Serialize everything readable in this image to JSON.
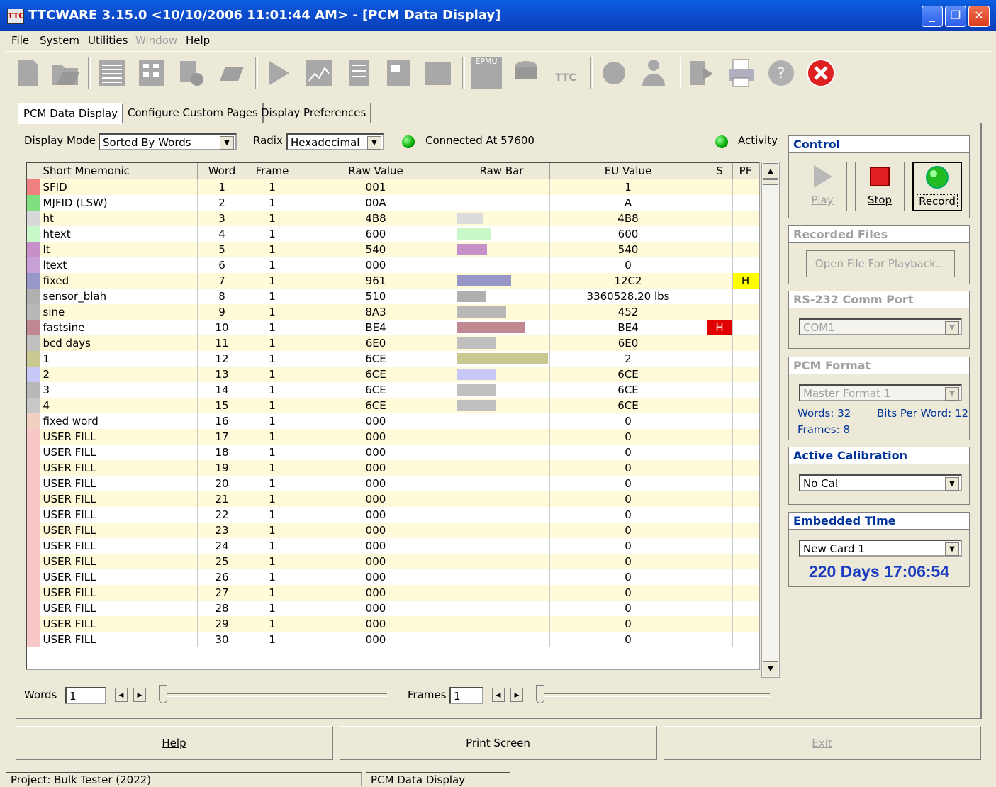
{
  "window": {
    "title": "TTCWARE 3.15.0 <10/10/2006 11:01:44 AM>  - [PCM Data Display]",
    "app_icon_text": "TTC"
  },
  "menu": [
    {
      "label": "File",
      "enabled": true
    },
    {
      "label": "System",
      "enabled": true
    },
    {
      "label": "Utilities",
      "enabled": true
    },
    {
      "label": "Window",
      "enabled": false
    },
    {
      "label": "Help",
      "enabled": true
    }
  ],
  "toolbar": {
    "icons": [
      "new-file-icon",
      "open-folder-icon",
      "list-view-icon",
      "grid-view-icon",
      "settings-gear-icon",
      "tape-icon",
      "play-icon",
      "chart-icon",
      "document-icon",
      "card-icon",
      "module-icon",
      "epmu-icon",
      "disk-icon",
      "ttc-icon",
      "network-icon",
      "user-icon",
      "export-icon",
      "print-icon",
      "help-icon",
      "close-icon"
    ],
    "epmu_label": "EPMU",
    "ttc_label": "TTC"
  },
  "tabs": [
    "PCM Data Display",
    "Configure Custom Pages",
    "Display Preferences"
  ],
  "display_mode": {
    "label": "Display Mode",
    "value": "Sorted By Words"
  },
  "radix": {
    "label": "Radix",
    "value": "Hexadecimal"
  },
  "connection": {
    "status": "Connected At 57600"
  },
  "activity": {
    "label": "Activity"
  },
  "grid": {
    "columns": [
      "Short Mnemonic",
      "Word",
      "Frame",
      "Raw Value",
      "Raw Bar",
      "EU Value",
      "S",
      "PF"
    ],
    "rows": [
      {
        "color": "#f08080",
        "mnemonic": "SFID",
        "word": "1",
        "frame": "1",
        "raw": "001",
        "bar": 0,
        "bar_color": "",
        "eu": "1",
        "s": "",
        "s_color": "",
        "pf": "",
        "pf_color": ""
      },
      {
        "color": "#80e080",
        "mnemonic": "MJFID (LSW)",
        "word": "2",
        "frame": "1",
        "raw": "00A",
        "bar": 0,
        "bar_color": "",
        "eu": "A",
        "s": "",
        "s_color": "",
        "pf": "",
        "pf_color": ""
      },
      {
        "color": "#d8d8d8",
        "mnemonic": "ht",
        "word": "3",
        "frame": "1",
        "raw": "4B8",
        "bar": 0.29,
        "bar_color": "#dcdcdc",
        "eu": "4B8",
        "s": "",
        "s_color": "",
        "pf": "",
        "pf_color": ""
      },
      {
        "color": "#c8f8c8",
        "mnemonic": "htext",
        "word": "4",
        "frame": "1",
        "raw": "600",
        "bar": 0.37,
        "bar_color": "#c8f8c8",
        "eu": "600",
        "s": "",
        "s_color": "",
        "pf": "",
        "pf_color": ""
      },
      {
        "color": "#c890c8",
        "mnemonic": "lt",
        "word": "5",
        "frame": "1",
        "raw": "540",
        "bar": 0.33,
        "bar_color": "#c890c8",
        "eu": "540",
        "s": "",
        "s_color": "",
        "pf": "",
        "pf_color": ""
      },
      {
        "color": "#c8a0d8",
        "mnemonic": "ltext",
        "word": "6",
        "frame": "1",
        "raw": "000",
        "bar": 0,
        "bar_color": "",
        "eu": "0",
        "s": "",
        "s_color": "",
        "pf": "",
        "pf_color": ""
      },
      {
        "color": "#9898c8",
        "mnemonic": "fixed",
        "word": "7",
        "frame": "1",
        "raw": "961",
        "bar": 0.59,
        "bar_color": "#9898c8",
        "eu": "12C2",
        "s": "",
        "s_color": "",
        "pf": "H",
        "pf_color": "#ffff00"
      },
      {
        "color": "#b0b0b0",
        "mnemonic": "sensor_blah",
        "word": "8",
        "frame": "1",
        "raw": "510",
        "bar": 0.31,
        "bar_color": "#b0b0b0",
        "eu": "3360528.20 lbs",
        "s": "",
        "s_color": "",
        "pf": "",
        "pf_color": ""
      },
      {
        "color": "#b8b8b8",
        "mnemonic": "sine",
        "word": "9",
        "frame": "1",
        "raw": "8A3",
        "bar": 0.54,
        "bar_color": "#b8b8b8",
        "eu": "452",
        "s": "",
        "s_color": "",
        "pf": "",
        "pf_color": ""
      },
      {
        "color": "#c08890",
        "mnemonic": "fastsine",
        "word": "10",
        "frame": "1",
        "raw": "BE4",
        "bar": 0.74,
        "bar_color": "#c08890",
        "eu": "BE4",
        "s": "H",
        "s_color": "#e00000",
        "pf": "",
        "pf_color": ""
      },
      {
        "color": "#c0c0c0",
        "mnemonic": "bcd days",
        "word": "11",
        "frame": "1",
        "raw": "6E0",
        "bar": 0.43,
        "bar_color": "#c0c0c0",
        "eu": "6E0",
        "s": "",
        "s_color": "",
        "pf": "",
        "pf_color": ""
      },
      {
        "color": "#c8c890",
        "mnemonic": "1",
        "word": "12",
        "frame": "1",
        "raw": "6CE",
        "bar": 1.0,
        "bar_color": "#c8c890",
        "eu": "2",
        "s": "",
        "s_color": "",
        "pf": "",
        "pf_color": ""
      },
      {
        "color": "#c8c8f8",
        "mnemonic": "2",
        "word": "13",
        "frame": "1",
        "raw": "6CE",
        "bar": 0.43,
        "bar_color": "#c8c8f8",
        "eu": "6CE",
        "s": "",
        "s_color": "",
        "pf": "",
        "pf_color": ""
      },
      {
        "color": "#b8b8b8",
        "mnemonic": "3",
        "word": "14",
        "frame": "1",
        "raw": "6CE",
        "bar": 0.43,
        "bar_color": "#c0c0c0",
        "eu": "6CE",
        "s": "",
        "s_color": "",
        "pf": "",
        "pf_color": ""
      },
      {
        "color": "#c8c8c8",
        "mnemonic": "4",
        "word": "15",
        "frame": "1",
        "raw": "6CE",
        "bar": 0.43,
        "bar_color": "#c0c0c0",
        "eu": "6CE",
        "s": "",
        "s_color": "",
        "pf": "",
        "pf_color": ""
      },
      {
        "color": "#f0d0c0",
        "mnemonic": "fixed word",
        "word": "16",
        "frame": "1",
        "raw": "000",
        "bar": 0,
        "bar_color": "",
        "eu": "0",
        "s": "",
        "s_color": "",
        "pf": "",
        "pf_color": ""
      },
      {
        "color": "#f8c8c8",
        "mnemonic": "USER FILL",
        "word": "17",
        "frame": "1",
        "raw": "000",
        "bar": 0,
        "bar_color": "",
        "eu": "0",
        "s": "",
        "s_color": "",
        "pf": "",
        "pf_color": ""
      },
      {
        "color": "#f8c8c8",
        "mnemonic": "USER FILL",
        "word": "18",
        "frame": "1",
        "raw": "000",
        "bar": 0,
        "bar_color": "",
        "eu": "0",
        "s": "",
        "s_color": "",
        "pf": "",
        "pf_color": ""
      },
      {
        "color": "#f8c8c8",
        "mnemonic": "USER FILL",
        "word": "19",
        "frame": "1",
        "raw": "000",
        "bar": 0,
        "bar_color": "",
        "eu": "0",
        "s": "",
        "s_color": "",
        "pf": "",
        "pf_color": ""
      },
      {
        "color": "#f8c8c8",
        "mnemonic": "USER FILL",
        "word": "20",
        "frame": "1",
        "raw": "000",
        "bar": 0,
        "bar_color": "",
        "eu": "0",
        "s": "",
        "s_color": "",
        "pf": "",
        "pf_color": ""
      },
      {
        "color": "#f8c8c8",
        "mnemonic": "USER FILL",
        "word": "21",
        "frame": "1",
        "raw": "000",
        "bar": 0,
        "bar_color": "",
        "eu": "0",
        "s": "",
        "s_color": "",
        "pf": "",
        "pf_color": ""
      },
      {
        "color": "#f8c8c8",
        "mnemonic": "USER FILL",
        "word": "22",
        "frame": "1",
        "raw": "000",
        "bar": 0,
        "bar_color": "",
        "eu": "0",
        "s": "",
        "s_color": "",
        "pf": "",
        "pf_color": ""
      },
      {
        "color": "#f8c8c8",
        "mnemonic": "USER FILL",
        "word": "23",
        "frame": "1",
        "raw": "000",
        "bar": 0,
        "bar_color": "",
        "eu": "0",
        "s": "",
        "s_color": "",
        "pf": "",
        "pf_color": ""
      },
      {
        "color": "#f8c8c8",
        "mnemonic": "USER FILL",
        "word": "24",
        "frame": "1",
        "raw": "000",
        "bar": 0,
        "bar_color": "",
        "eu": "0",
        "s": "",
        "s_color": "",
        "pf": "",
        "pf_color": ""
      },
      {
        "color": "#f8c8c8",
        "mnemonic": "USER FILL",
        "word": "25",
        "frame": "1",
        "raw": "000",
        "bar": 0,
        "bar_color": "",
        "eu": "0",
        "s": "",
        "s_color": "",
        "pf": "",
        "pf_color": ""
      },
      {
        "color": "#f8c8c8",
        "mnemonic": "USER FILL",
        "word": "26",
        "frame": "1",
        "raw": "000",
        "bar": 0,
        "bar_color": "",
        "eu": "0",
        "s": "",
        "s_color": "",
        "pf": "",
        "pf_color": ""
      },
      {
        "color": "#f8c8c8",
        "mnemonic": "USER FILL",
        "word": "27",
        "frame": "1",
        "raw": "000",
        "bar": 0,
        "bar_color": "",
        "eu": "0",
        "s": "",
        "s_color": "",
        "pf": "",
        "pf_color": ""
      },
      {
        "color": "#f8c8c8",
        "mnemonic": "USER FILL",
        "word": "28",
        "frame": "1",
        "raw": "000",
        "bar": 0,
        "bar_color": "",
        "eu": "0",
        "s": "",
        "s_color": "",
        "pf": "",
        "pf_color": ""
      },
      {
        "color": "#f8c8c8",
        "mnemonic": "USER FILL",
        "word": "29",
        "frame": "1",
        "raw": "000",
        "bar": 0,
        "bar_color": "",
        "eu": "0",
        "s": "",
        "s_color": "",
        "pf": "",
        "pf_color": ""
      },
      {
        "color": "#f8c8c8",
        "mnemonic": "USER FILL",
        "word": "30",
        "frame": "1",
        "raw": "000",
        "bar": 0,
        "bar_color": "",
        "eu": "0",
        "s": "",
        "s_color": "",
        "pf": "",
        "pf_color": ""
      }
    ]
  },
  "nav": {
    "words_label": "Words",
    "words_value": "1",
    "frames_label": "Frames",
    "frames_value": "1"
  },
  "control": {
    "title": "Control",
    "play_label": "Play",
    "stop_label": "Stop",
    "record_label": "Record"
  },
  "recorded_files": {
    "title": "Recorded Files",
    "open_label": "Open File For Playback..."
  },
  "comm_port": {
    "title": "RS-232 Comm Port",
    "value": "COM1"
  },
  "pcm_format": {
    "title": "PCM Format",
    "value": "Master Format 1",
    "words": "Words: 32",
    "bits_per_word": "Bits Per Word: 12",
    "frames": "Frames: 8"
  },
  "calibration": {
    "title": "Active Calibration",
    "value": "No Cal"
  },
  "embedded_time": {
    "title": "Embedded Time",
    "value": "New Card 1",
    "time": "220 Days 17:06:54"
  },
  "buttons": {
    "help": "Help",
    "print": "Print Screen",
    "exit": "Exit"
  },
  "status": {
    "project": "Project: Bulk Tester (2022)",
    "view": "PCM Data Display"
  },
  "colors": {
    "accent": "#003399",
    "time": "#1a3cbf",
    "led": "#00aa00"
  }
}
